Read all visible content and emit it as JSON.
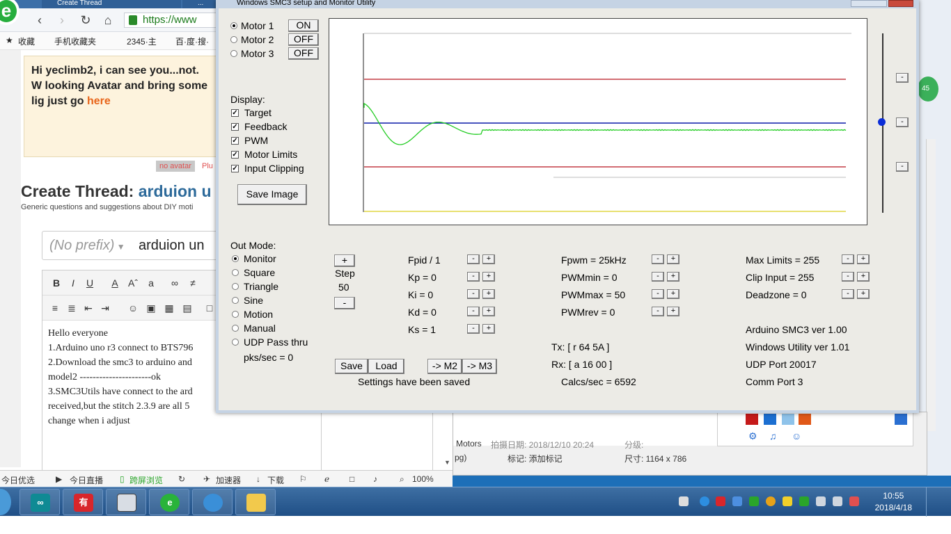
{
  "browser": {
    "tabs": [
      "Create Thread",
      "..."
    ],
    "url": "https://www",
    "favorites": [
      "收藏",
      "手机收藏夹",
      "2345·主",
      "百·度·搜·"
    ],
    "notice": {
      "text": "Hi yeclimb2, i can see you...not. W looking Avatar and bring some lig just go",
      "link": "here"
    },
    "avatar_tag": "no avatar",
    "avatar_plu": "Plu",
    "create_thread": {
      "title_prefix": "Create Thread:",
      "title_name": "arduion u",
      "subtitle": "Generic questions and suggestions about DIY moti"
    },
    "prefix": "(No prefix)",
    "thread_title": "arduion un",
    "editor_lines": [
      "Hello everyone",
      "1.Arduino uno r3 connect to BTS796",
      "2.Download the smc3 to arduino and",
      "model2 ----------------------ok",
      "3.SMC3Utils have connect to the ard",
      "received,but the stitch 2.3.9 are all 5",
      "change when i adjust"
    ],
    "status": [
      "今日优选",
      "今日直播",
      "跨屏浏览",
      "加速器",
      "下载",
      "100%"
    ]
  },
  "dialog": {
    "title": "Windows SMC3 setup and Monitor Utility",
    "motors": [
      {
        "label": "Motor 1",
        "state": "ON",
        "selected": true
      },
      {
        "label": "Motor 2",
        "state": "OFF",
        "selected": false
      },
      {
        "label": "Motor 3",
        "state": "OFF",
        "selected": false
      }
    ],
    "display_label": "Display:",
    "display_options": [
      "Target",
      "Feedback",
      "PWM",
      "Motor Limits",
      "Input Clipping"
    ],
    "save_image": "Save Image",
    "out_mode_label": "Out Mode:",
    "out_modes": [
      "Monitor",
      "Square",
      "Triangle",
      "Sine",
      "Motion",
      "Manual",
      "UDP Pass thru"
    ],
    "pks_sec": "pks/sec = 0",
    "step": {
      "plus": "+",
      "label": "Step",
      "value": "50",
      "minus": "-"
    },
    "params": [
      {
        "label": "Fpid / 1"
      },
      {
        "label": "Kp = 0"
      },
      {
        "label": "Ki = 0"
      },
      {
        "label": "Kd = 0"
      },
      {
        "label": "Ks = 1"
      }
    ],
    "pwm": [
      {
        "label": "Fpwm = 25kHz"
      },
      {
        "label": "PWMmin = 0"
      },
      {
        "label": "PWMmax = 50"
      },
      {
        "label": "PWMrev = 0"
      }
    ],
    "limits": [
      {
        "label": "Max Limits = 255"
      },
      {
        "label": "Clip Input = 255"
      },
      {
        "label": "Deadzone = 0"
      }
    ],
    "buttons": {
      "save": "Save",
      "load": "Load",
      "m2": "-> M2",
      "m3": "-> M3"
    },
    "settings_status": "Settings have been saved",
    "tx": "Tx: [ r 64 5A ]",
    "rx": "Rx: [ a 16 00 ]",
    "calcs": "Calcs/sec = 6592",
    "info": [
      "Arduino SMC3 ver 1.00",
      "Windows Utility ver 1.01",
      "UDP Port 20017",
      "Comm Port 3"
    ],
    "side_buttons": [
      "-",
      "-",
      "-"
    ],
    "plot_colors": {
      "limits": "#b8141e",
      "target": "#0a1aa8",
      "feedback": "#22cc22",
      "clip": "#e8e070",
      "grid": "#bbbbbb"
    }
  },
  "bgwindow": {
    "motors_label": "Motors",
    "date": "拍摄日期: 2018/12/10 20:24",
    "label1": "pg)",
    "tag": "标记: 添加标记",
    "rating": "分级:",
    "size": "尺寸: 1164 x 786"
  },
  "taskbar": {
    "time": "10:55",
    "date": "2018/4/18",
    "apps": [
      "arduino",
      "有道",
      "window",
      "ie",
      "qq",
      "explorer"
    ]
  }
}
